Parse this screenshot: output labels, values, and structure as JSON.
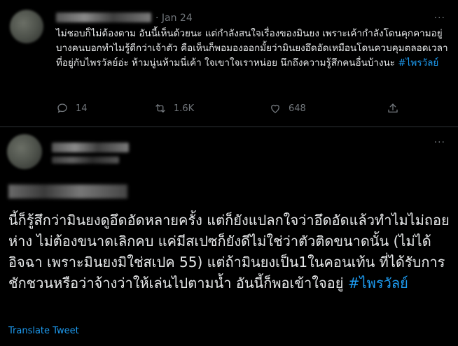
{
  "tweet1": {
    "date": "· Jan 24",
    "more": "···",
    "text_main": "ไม่ชอบก็ไม่ต้องตาม อันนี้เห็นด้วยนะ แต่กำลังสนใจเรื่องของมินยง เพราะเค้ากำลังโดนคุกคามอยู่ บางคนบอกทำไมรู้ดีกว่าเจ้าตัว คือเห็นก็พอมองออกมั้ยว่ามินยงอึดอัดเหมือนโดนควบคุมตลอดเวลาที่อยู่กับไพรวัลย์อ่ะ ห้ามนู่นห้ามนี่เค้า ใจเขาใจเราหน่อย นึกถึงความรู้สึกคนอื่นบ้างนะ ",
    "hashtag": "#ไพรวัลย์",
    "actions": {
      "reply_count": "14",
      "retweet_count": "1.6K",
      "like_count": "648"
    }
  },
  "tweet2": {
    "more": "···",
    "text_main": "นี้ก็รู้สึกว่ามินยงดูอึดอัดหลายครั้ง แต่ก็ยังแปลกใจว่าอึดอัดแล้วทำไมไม่ถอยห่าง ไม่ต้องขนาดเลิกคบ แค่มีสเปซก็ยังดีไม่ใช่ว่าตัวติดขนาดนั้น (ไม่ได้อิจฉา เพราะมินยงมิใช่สเปค 55) แต่ถ้ามินยงเป็น1ในคอนเท้น ที่ได้รับการชักชวนหรือว่าจ้างว่าให้เล่นไปตามน้ำ อันนี้ก็พอเข้าใจอยู่ ",
    "hashtag": "#ไพรวัลย์",
    "translate": "Translate Tweet"
  },
  "colors": {
    "background": "#000000",
    "text": "#e7e9ea",
    "muted": "#71767b",
    "link": "#1d9bf0",
    "divider": "#2f3336"
  },
  "icons": [
    "reply-icon",
    "retweet-icon",
    "like-icon",
    "more-icon"
  ]
}
